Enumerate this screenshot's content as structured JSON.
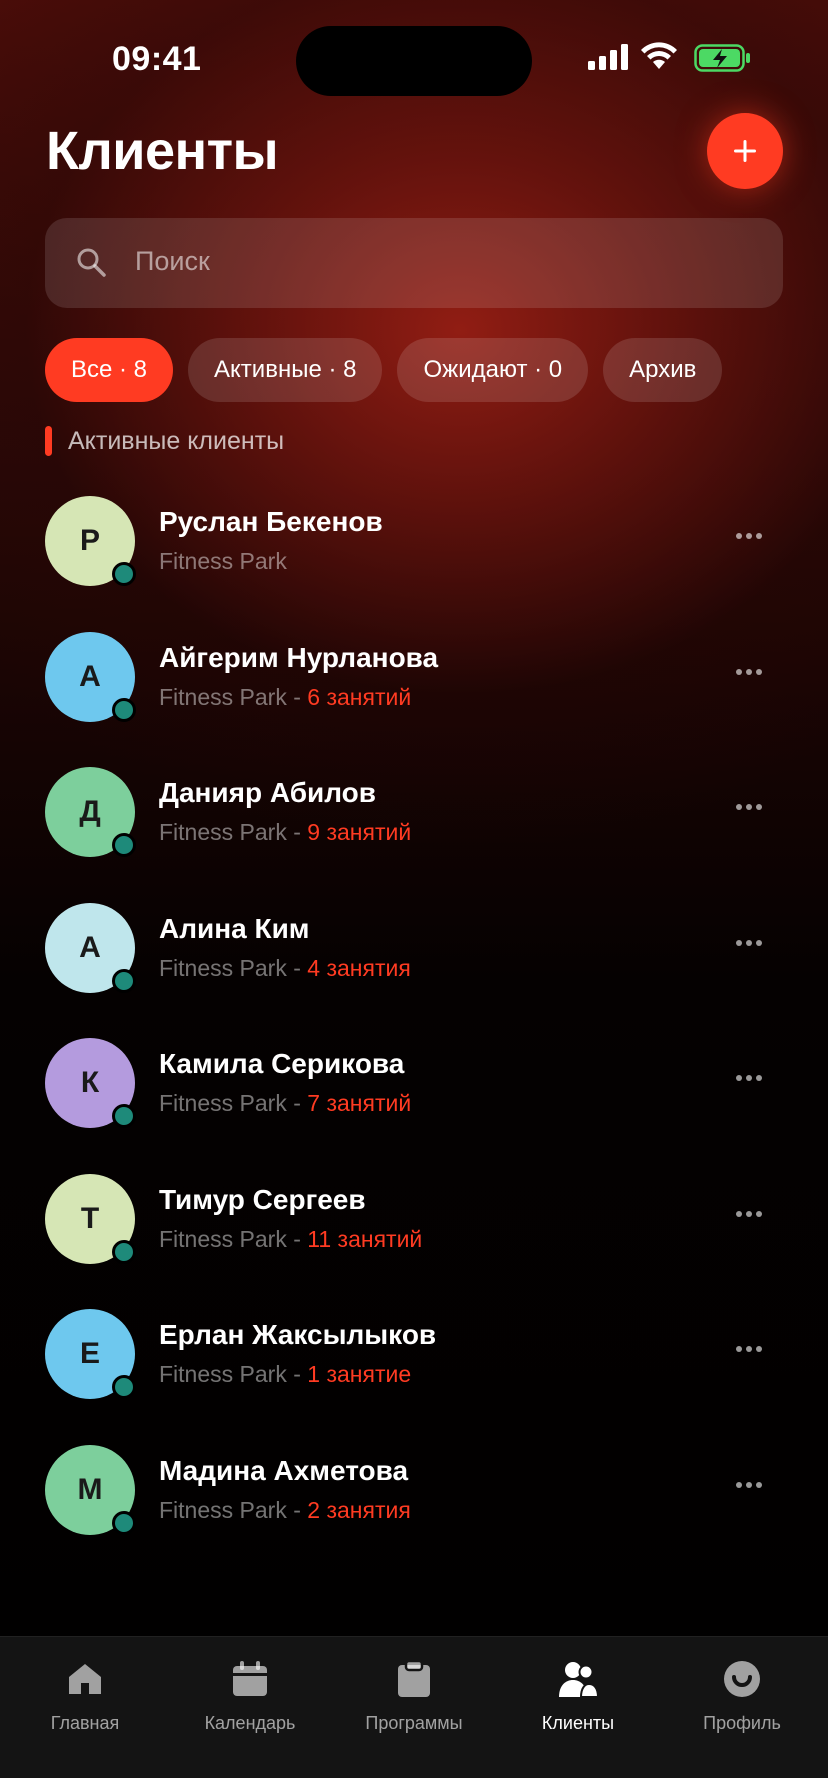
{
  "status_bar": {
    "time": "09:41"
  },
  "header": {
    "title": "Клиенты",
    "add_icon": "plus-icon"
  },
  "search": {
    "placeholder": "Поиск"
  },
  "filters": [
    {
      "label": "Все · 8",
      "active": true
    },
    {
      "label": "Активные · 8",
      "active": false
    },
    {
      "label": "Ожидают · 0",
      "active": false
    },
    {
      "label": "Архив",
      "active": false
    }
  ],
  "section": {
    "label": "Активные клиенты"
  },
  "clients": [
    {
      "initial": "Р",
      "name": "Руслан Бекенов",
      "gym": "Fitness Park",
      "sessions": "",
      "color": "#d6e6b5"
    },
    {
      "initial": "А",
      "name": "Айгерим Нурланова",
      "gym": "Fitness Park",
      "sessions": "6 занятий",
      "color": "#6ec8ee"
    },
    {
      "initial": "Д",
      "name": "Данияр Абилов",
      "gym": "Fitness Park",
      "sessions": "9 занятий",
      "color": "#7dcf9c"
    },
    {
      "initial": "А",
      "name": "Алина Ким",
      "gym": "Fitness Park",
      "sessions": "4 занятия",
      "color": "#bfe6ec"
    },
    {
      "initial": "К",
      "name": "Камила Серикова",
      "gym": "Fitness Park",
      "sessions": "7 занятий",
      "color": "#b49bde"
    },
    {
      "initial": "Т",
      "name": "Тимур Сергеев",
      "gym": "Fitness Park",
      "sessions": "11 занятий",
      "color": "#d6e6b5"
    },
    {
      "initial": "Е",
      "name": "Ерлан Жаксылыков",
      "gym": "Fitness Park",
      "sessions": "1 занятие",
      "color": "#6ec8ee"
    },
    {
      "initial": "М",
      "name": "Мадина Ахметова",
      "gym": "Fitness Park",
      "sessions": "2 занятия",
      "color": "#7dcf9c"
    }
  ],
  "tabbar": [
    {
      "label": "Главная",
      "icon": "home-icon",
      "current": false
    },
    {
      "label": "Календарь",
      "icon": "calendar-icon",
      "current": false
    },
    {
      "label": "Программы",
      "icon": "clipboard-icon",
      "current": false
    },
    {
      "label": "Клиенты",
      "icon": "clients-icon",
      "current": true
    },
    {
      "label": "Профиль",
      "icon": "profile-icon",
      "current": false
    }
  ],
  "colors": {
    "accent": "#ff3b22",
    "online_dot": "#1e8a7a"
  }
}
